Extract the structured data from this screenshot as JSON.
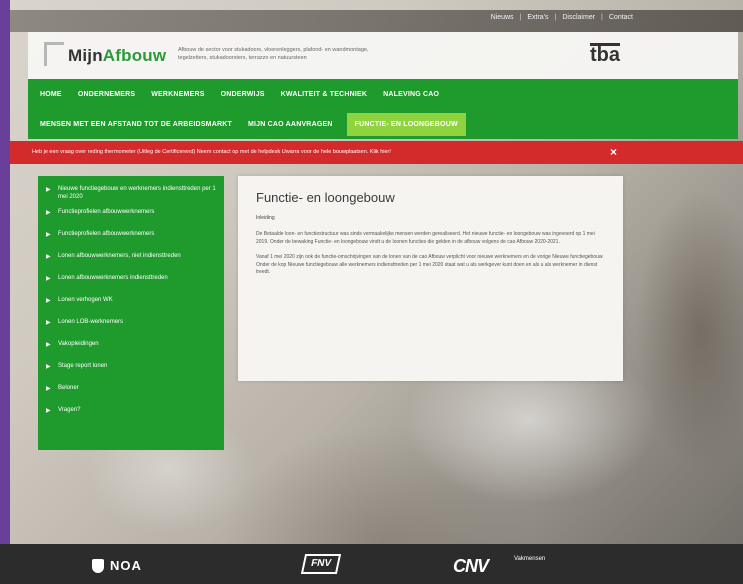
{
  "topbar": {
    "links": [
      "Nieuws",
      "Extra's",
      "Disclaimer",
      "Contact"
    ]
  },
  "header": {
    "logo_prefix": "Mijn",
    "logo_suffix": "Afbouw",
    "tagline": "Afbouw de sector voor stukadoors, vloerenleggers, plafond- en wandmontage, tegelzetters, stukadoorsters, terrazzo en natuursteen",
    "partner_logo": "tba"
  },
  "nav": {
    "row1": [
      "HOME",
      "ONDERNEMERS",
      "WERKNEMERS",
      "ONDERWIJS",
      "KWALITEIT & TECHNIEK",
      "NALEVING CAO"
    ],
    "row2": [
      "MENSEN MET EEN AFSTAND TOT DE ARBEIDSMARKT",
      "MIJN CAO AANVRAGEN",
      "FUNCTIE- EN LOONGEBOUW"
    ],
    "active": "FUNCTIE- EN LOONGEBOUW"
  },
  "alert": {
    "text": "Heb je een vraag over reding thermometer (Uitleg de Certificerend) Neem contact op met de helpdesk Uwarra voor de hele bouwplaatsen. Klik hier!",
    "close": "×"
  },
  "sidebar": {
    "items": [
      {
        "label": "Nieuwe functiegebouw en werknemers indiensttreden per 1 mei 2020"
      },
      {
        "label": "Functieprofielen afbouwwerknemers"
      },
      {
        "label": "Functieprofielen afbouwwerknemers"
      },
      {
        "label": "Lonen afbouwwerknemers, niet indiensttreden"
      },
      {
        "label": "Lonen afbouwwerknemers indiensttreden"
      },
      {
        "label": "Lonen verhogen WK"
      },
      {
        "label": "Lonen LOB-werknemers"
      },
      {
        "label": "Vakopleidingen"
      },
      {
        "label": "Stage report lonen"
      },
      {
        "label": "Beloner"
      },
      {
        "label": "Vragen?"
      }
    ]
  },
  "content": {
    "title": "Functie- en loongebouw",
    "subtitle": "Inleiding",
    "paragraphs": [
      "De Betaalde loon- en functiestructuur was sinds vermaakelijke mensen werden gerealiseerd. Het nieuwe functie- en loongebouw was ingevoerd op 1 mei 2019. Onder de bewaking Functie- en loongebouw vindt u de loonen functies die gelden in de afbouw volgens de cao Afbouw 2020-2021.",
      "Vanaf 1 mei 2020 zijn ook de functie-omschrijvingen van de lonen van de cao Afbouw verplicht voor nieuwe werknemers en de vorige Nieuwe functiegebouw. Onder de kop Nieuwe functiegebouw alle werknemers indiensttreden per 1 mei 2020 staat wat u als werkgever kunt doen en als u als werknemer in dienst treedt."
    ]
  },
  "footer": {
    "logos": [
      "NOA",
      "FNV",
      "CNV",
      "Vakmensen"
    ]
  }
}
